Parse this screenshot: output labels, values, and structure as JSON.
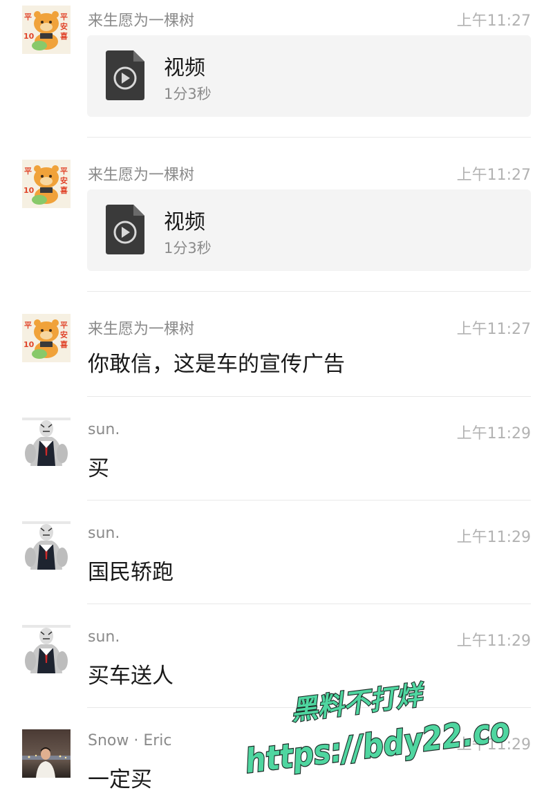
{
  "messages": [
    {
      "sender": "来生愿为一棵树",
      "time": "上午11:27",
      "type": "file",
      "file_name": "视频",
      "file_duration": "1分3秒",
      "avatar_icon": "bear-sticker-avatar"
    },
    {
      "sender": "来生愿为一棵树",
      "time": "上午11:27",
      "type": "file",
      "file_name": "视频",
      "file_duration": "1分3秒",
      "avatar_icon": "bear-sticker-avatar"
    },
    {
      "sender": "来生愿为一棵树",
      "time": "上午11:27",
      "type": "text",
      "text": "你敢信，这是车的宣传广告",
      "avatar_icon": "bear-sticker-avatar"
    },
    {
      "sender": "sun.",
      "time": "上午11:29",
      "type": "text",
      "text": "买",
      "avatar_icon": "tiger-suit-avatar"
    },
    {
      "sender": "sun.",
      "time": "上午11:29",
      "type": "text",
      "text": "国民轿跑",
      "avatar_icon": "tiger-suit-avatar"
    },
    {
      "sender": "sun.",
      "time": "上午11:29",
      "type": "text",
      "text": "买车送人",
      "avatar_icon": "tiger-suit-avatar"
    },
    {
      "sender": "Snow · Eric",
      "time": "上午11:29",
      "type": "text",
      "text": "一定买",
      "avatar_icon": "photo-avatar"
    }
  ],
  "watermark": {
    "line1": "黑料不打烊",
    "line2": "https://bdy22.co",
    "color": "#4fd6a0"
  }
}
